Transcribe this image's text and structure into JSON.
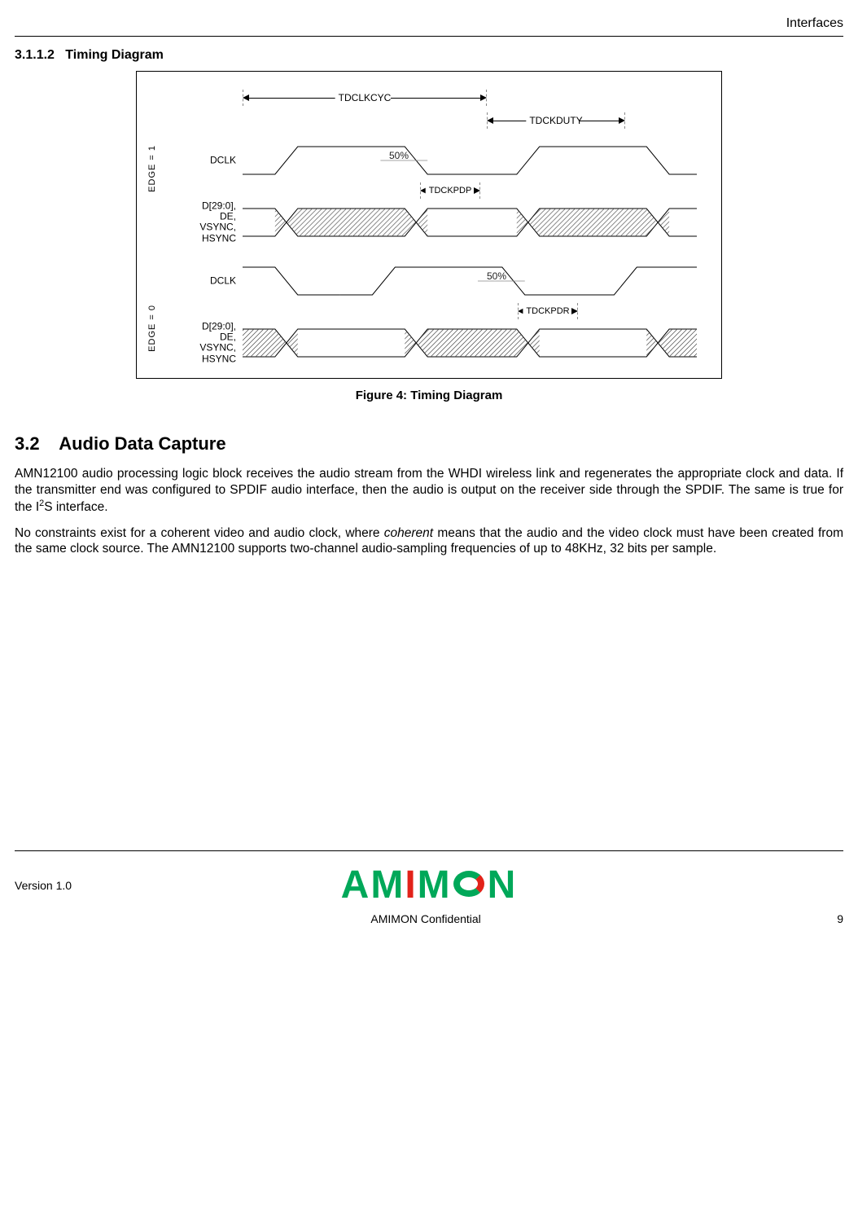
{
  "header": {
    "chapter": "Interfaces"
  },
  "sec_sub": {
    "number": "3.1.1.2",
    "title": "Timing Diagram"
  },
  "figure": {
    "caption": "Figure 4: Timing Diagram",
    "dims": {
      "cycle": "TDCLKCYC",
      "duty": "TDCKDUTY",
      "pdp": "TDCKPDP",
      "pdr": "TDCKPDR"
    },
    "edge1": "EDGE = 1",
    "edge0": "EDGE = 0",
    "sig_dclk": "DCLK",
    "sig_data": "D[29:0],\nDE,\nVSYNC,\nHSYNC",
    "fifty": "50%"
  },
  "sec_main": {
    "number": "3.2",
    "title": "Audio Data Capture"
  },
  "paragraphs": {
    "p1a": "AMN12100 audio processing logic block receives the audio stream from the WHDI wireless link and regenerates the appropriate clock and data. If the transmitter end was configured to SPDIF audio interface, then the audio is output on the receiver side through the SPDIF. The same is true for the I",
    "p1b": "S interface.",
    "p2a": "No constraints exist for a coherent video and audio clock, where ",
    "p2b": "coherent",
    "p2c": " means that the audio and the video clock must have been created from the same clock source. The AMN12100 supports two-channel audio-sampling frequencies of up to 48KHz, 32 bits per sample."
  },
  "footer": {
    "version": "Version 1.0",
    "conf": "AMIMON Confidential",
    "page": "9"
  }
}
